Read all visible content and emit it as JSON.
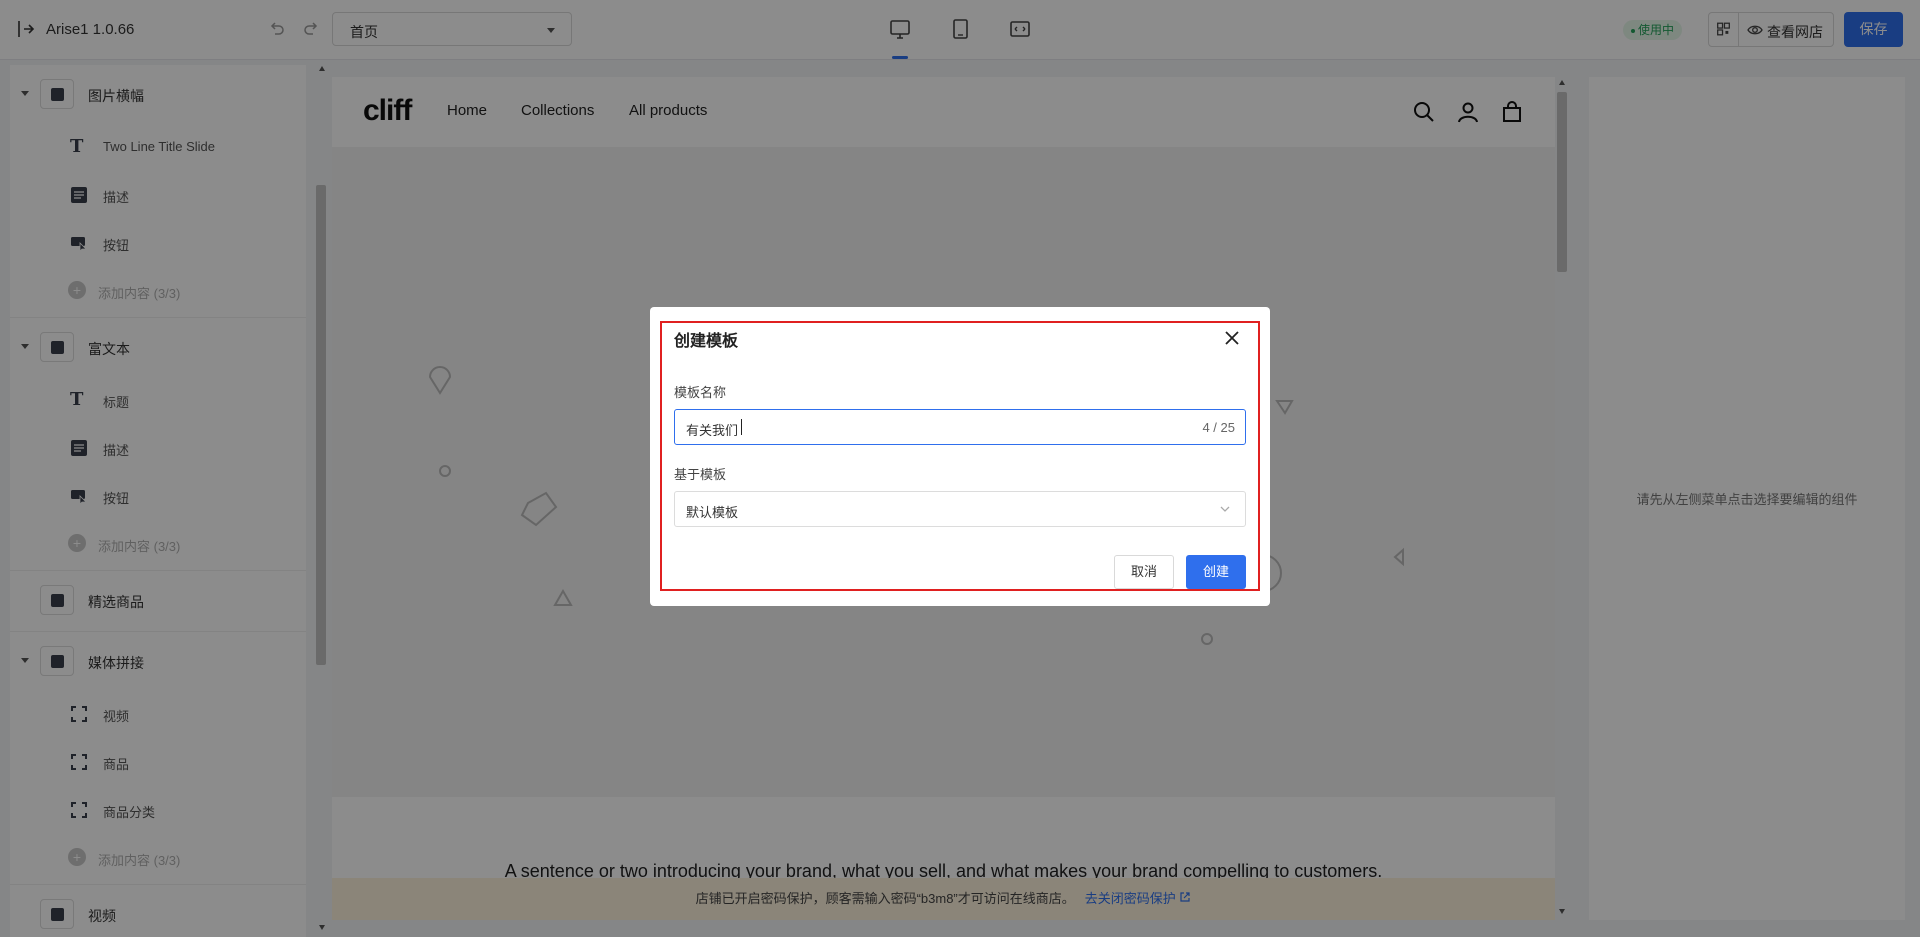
{
  "topbar": {
    "app_title": "Arise1 1.0.66",
    "page_select_value": "首页",
    "status_badge": "使用中",
    "view_store_label": "查看网店",
    "save_label": "保存"
  },
  "sidebar": {
    "sections": [
      {
        "label": "图片横幅",
        "children": [
          {
            "label": "Two Line Title Slide",
            "icon": "text-icon"
          },
          {
            "label": "描述",
            "icon": "paragraph-icon"
          },
          {
            "label": "按钮",
            "icon": "button-icon"
          }
        ],
        "add_label": "添加内容 (3/3)"
      },
      {
        "label": "富文本",
        "children": [
          {
            "label": "标题",
            "icon": "text-icon"
          },
          {
            "label": "描述",
            "icon": "paragraph-icon"
          },
          {
            "label": "按钮",
            "icon": "button-icon"
          }
        ],
        "add_label": "添加内容 (3/3)"
      },
      {
        "label": "精选商品"
      },
      {
        "label": "媒体拼接",
        "children": [
          {
            "label": "视频",
            "icon": "frame-icon"
          },
          {
            "label": "商品",
            "icon": "frame-icon"
          },
          {
            "label": "商品分类",
            "icon": "frame-icon"
          }
        ],
        "add_label": "添加内容 (3/3)"
      },
      {
        "label": "视频"
      }
    ]
  },
  "preview": {
    "logo": "cliff",
    "nav": [
      "Home",
      "Collections",
      "All products"
    ],
    "intro_text": "A sentence or two introducing your brand, what you sell, and what makes your brand compelling to customers.",
    "banner_text": "店铺已开启密码保护，顾客需输入密码“b3m8”才可访问在线商店。",
    "banner_link": "去关闭密码保护"
  },
  "right_panel": {
    "hint": "请先从左侧菜单点击选择要编辑的组件"
  },
  "modal": {
    "title": "创建模板",
    "name_label": "模板名称",
    "name_value": "有关我们",
    "name_count": "4 / 25",
    "base_label": "基于模板",
    "base_value": "默认模板",
    "cancel_label": "取消",
    "create_label": "创建"
  },
  "colors": {
    "accent": "#2f6fed",
    "highlight_border": "#e02020",
    "status_green": "#23a35a"
  }
}
